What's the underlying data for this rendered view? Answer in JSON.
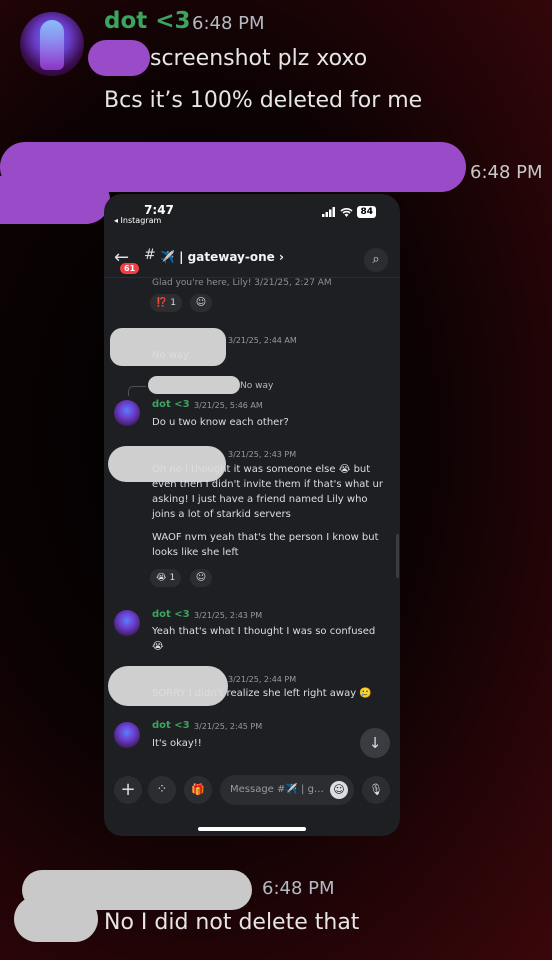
{
  "outer_chat": {
    "author": "dot <3",
    "time": "6:48 PM",
    "line1": "screenshot plz xoxo",
    "line2": "Bcs it’s 100% deleted for me",
    "reply_time": "6:48 PM",
    "final_time": "6:48 PM",
    "final_text": "No I did not delete that",
    "colors": {
      "author": "#3ba55d",
      "redact_purple": "#9a4bc8",
      "redact_grey": "#c9c9c9"
    }
  },
  "phone": {
    "status": {
      "time": "7:47",
      "back_app": "◂ Instagram",
      "battery": "84",
      "signal_icon": "signal-bars-icon",
      "wifi_icon": "wifi-icon"
    },
    "header": {
      "badge": "61",
      "hash": "#",
      "channel": "✈️ | gateway-one ›"
    },
    "messages": {
      "partial_top": "Glad you're here, Lily! 3/21/25, 2:27 AM",
      "reaction_top": {
        "emoji": "⁉️",
        "count": "1",
        "add": "☺"
      },
      "m1": {
        "ts": "3/21/25, 2:44 AM",
        "text": "No way"
      },
      "reply_preview": "No way",
      "m2": {
        "author": "dot <3",
        "ts": "3/21/25, 5:46 AM",
        "text": "Do u two know each other?"
      },
      "m3": {
        "ts": "3/21/25, 2:43 PM",
        "text1": "Oh no I thought it was someone else 😭 but even then I didn't invite them if that's what ur asking! I just have a friend named Lily who joins a lot of starkid servers",
        "text2": "WAOF nvm yeah that's the person I know but looks like she left",
        "reaction": {
          "emoji": "😭",
          "count": "1",
          "add": "☺"
        }
      },
      "m4": {
        "author": "dot <3",
        "ts": "3/21/25, 2:43 PM",
        "text": "Yeah that's what I thought I was so confused 😭"
      },
      "m5": {
        "ts": "3/21/25, 2:44 PM",
        "text": "SORRY I didn't realize she left right away 🥲"
      },
      "m6": {
        "author": "dot <3",
        "ts": "3/21/25, 2:45 PM",
        "text": "It's okay!!"
      }
    },
    "composer": {
      "plus": "+",
      "apps": "⁘",
      "gift": "🎁",
      "placeholder": "Message #✈️ | g…",
      "emoji": "☺",
      "mic": "🎙"
    },
    "jump_down": "↓"
  }
}
